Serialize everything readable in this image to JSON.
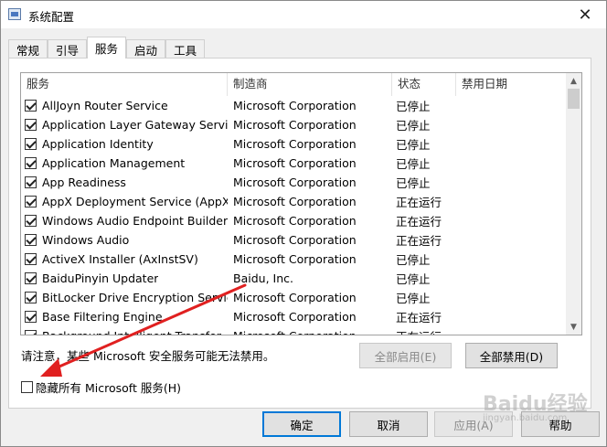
{
  "window": {
    "title": "系统配置",
    "close_glyph": "✕"
  },
  "tabs": [
    {
      "label": "常规"
    },
    {
      "label": "引导"
    },
    {
      "label": "服务",
      "active": true
    },
    {
      "label": "启动"
    },
    {
      "label": "工具"
    }
  ],
  "table": {
    "columns": [
      "服务",
      "制造商",
      "状态",
      "禁用日期"
    ],
    "rows": [
      {
        "name": "AllJoyn Router Service",
        "manufacturer": "Microsoft Corporation",
        "status": "已停止",
        "checked": true
      },
      {
        "name": "Application Layer Gateway Service",
        "manufacturer": "Microsoft Corporation",
        "status": "已停止",
        "checked": true
      },
      {
        "name": "Application Identity",
        "manufacturer": "Microsoft Corporation",
        "status": "已停止",
        "checked": true
      },
      {
        "name": "Application Management",
        "manufacturer": "Microsoft Corporation",
        "status": "已停止",
        "checked": true
      },
      {
        "name": "App Readiness",
        "manufacturer": "Microsoft Corporation",
        "status": "已停止",
        "checked": true
      },
      {
        "name": "AppX Deployment Service (AppX...",
        "manufacturer": "Microsoft Corporation",
        "status": "正在运行",
        "checked": true
      },
      {
        "name": "Windows Audio Endpoint Builder",
        "manufacturer": "Microsoft Corporation",
        "status": "正在运行",
        "checked": true
      },
      {
        "name": "Windows Audio",
        "manufacturer": "Microsoft Corporation",
        "status": "正在运行",
        "checked": true
      },
      {
        "name": "ActiveX Installer (AxInstSV)",
        "manufacturer": "Microsoft Corporation",
        "status": "已停止",
        "checked": true
      },
      {
        "name": "BaiduPinyin Updater",
        "manufacturer": "Baidu, Inc.",
        "status": "已停止",
        "checked": true
      },
      {
        "name": "BitLocker Drive Encryption Service",
        "manufacturer": "Microsoft Corporation",
        "status": "已停止",
        "checked": true
      },
      {
        "name": "Base Filtering Engine",
        "manufacturer": "Microsoft Corporation",
        "status": "正在运行",
        "checked": true
      },
      {
        "name": "Background Intelligent Transfer...",
        "manufacturer": "Microsoft Corporation",
        "status": "正在运行",
        "checked": true
      }
    ]
  },
  "note": "请注意，某些 Microsoft 安全服务可能无法禁用。",
  "buttons": {
    "enable_all": "全部启用(E)",
    "disable_all": "全部禁用(D)",
    "ok": "确定",
    "cancel": "取消",
    "apply": "应用(A)",
    "help": "帮助"
  },
  "hide_ms_services": {
    "label": "隐藏所有 Microsoft 服务(H)",
    "checked": false
  },
  "annotation_color": "#e02020",
  "watermark": {
    "text": "Baidu经验",
    "sub": "jingyan.baidu.com"
  }
}
